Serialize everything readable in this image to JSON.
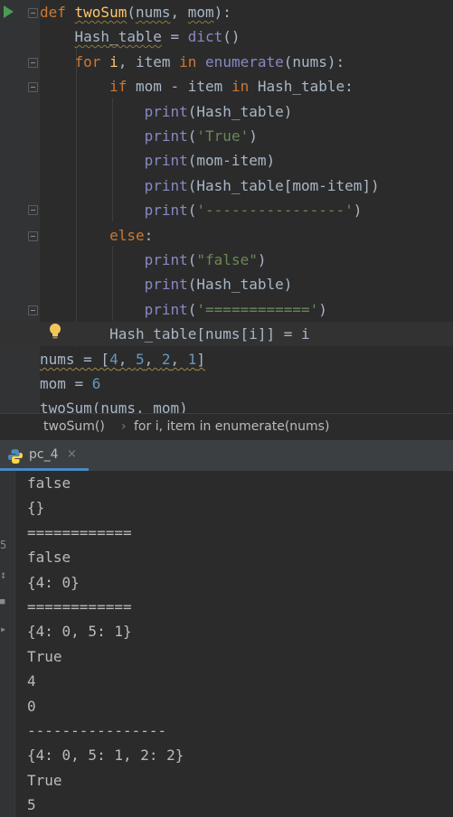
{
  "editor": {
    "lines": [
      {
        "parts": [
          [
            "kw",
            "def "
          ],
          [
            "fn wavy",
            "twoSum"
          ],
          [
            "",
            "("
          ],
          [
            "prm wavy",
            "nums"
          ],
          [
            "",
            ", "
          ],
          [
            "prm wavy",
            "mom"
          ],
          [
            "",
            "):"
          ]
        ]
      },
      {
        "parts": [
          [
            "",
            "    "
          ],
          [
            "wavy",
            "Hash_table"
          ],
          [
            "",
            " = "
          ],
          [
            "bi",
            "dict"
          ],
          [
            "",
            "()"
          ]
        ]
      },
      {
        "parts": [
          [
            "",
            "    "
          ],
          [
            "kw",
            "for "
          ],
          [
            "fn",
            "i"
          ],
          [
            "",
            ", item "
          ],
          [
            "kw",
            "in "
          ],
          [
            "bi",
            "enumerate"
          ],
          [
            "",
            "(nums):"
          ]
        ]
      },
      {
        "parts": [
          [
            "",
            "        "
          ],
          [
            "kw",
            "if "
          ],
          [
            "",
            "mom - item "
          ],
          [
            "kw",
            "in "
          ],
          [
            "",
            "Hash_table:"
          ]
        ]
      },
      {
        "parts": [
          [
            "",
            "            "
          ],
          [
            "bi",
            "print"
          ],
          [
            "",
            "(Hash_table)"
          ]
        ]
      },
      {
        "parts": [
          [
            "",
            "            "
          ],
          [
            "bi",
            "print"
          ],
          [
            "",
            "("
          ],
          [
            "str",
            "'True'"
          ],
          [
            "",
            ")"
          ]
        ]
      },
      {
        "parts": [
          [
            "",
            "            "
          ],
          [
            "bi",
            "print"
          ],
          [
            "",
            "(mom-item)"
          ]
        ]
      },
      {
        "parts": [
          [
            "",
            "            "
          ],
          [
            "bi",
            "print"
          ],
          [
            "",
            "(Hash_table[mom-item])"
          ]
        ]
      },
      {
        "parts": [
          [
            "",
            "            "
          ],
          [
            "bi",
            "print"
          ],
          [
            "",
            "("
          ],
          [
            "str",
            "'----------------'"
          ],
          [
            "",
            ")"
          ]
        ]
      },
      {
        "parts": [
          [
            "",
            "        "
          ],
          [
            "kw",
            "else"
          ],
          [
            "",
            ":"
          ]
        ]
      },
      {
        "parts": [
          [
            "",
            "            "
          ],
          [
            "bi",
            "print"
          ],
          [
            "",
            "("
          ],
          [
            "str",
            "\"false\""
          ],
          [
            "",
            ")"
          ]
        ]
      },
      {
        "parts": [
          [
            "",
            "            "
          ],
          [
            "bi",
            "print"
          ],
          [
            "",
            "(Hash_table)"
          ]
        ]
      },
      {
        "parts": [
          [
            "",
            "            "
          ],
          [
            "bi",
            "print"
          ],
          [
            "",
            "("
          ],
          [
            "str",
            "'============'"
          ],
          [
            "",
            ")"
          ]
        ]
      },
      {
        "parts": [
          [
            "",
            "        "
          ],
          [
            "",
            "Hash_table[nums["
          ],
          [
            "",
            "i"
          ],
          [
            "",
            "]] = i"
          ]
        ]
      },
      {
        "parts": [
          [
            "warn",
            "nums = ["
          ],
          [
            "num warn",
            "4"
          ],
          [
            "warn",
            ", "
          ],
          [
            "num warn",
            "5"
          ],
          [
            "warn",
            ", "
          ],
          [
            "num warn",
            "2"
          ],
          [
            "warn",
            ", "
          ],
          [
            "num warn",
            "1"
          ],
          [
            "warn",
            "]"
          ]
        ]
      },
      {
        "parts": [
          [
            "",
            "mom = "
          ],
          [
            "num",
            "6"
          ]
        ]
      },
      {
        "parts": [
          [
            "",
            "twoSum(nums, mom)"
          ]
        ]
      }
    ]
  },
  "breadcrumb": {
    "func": "twoSum()",
    "sep": "›",
    "loop": "for i, item in enumerate(nums)"
  },
  "run_panel": {
    "tab_label": "pc_4",
    "tab_close": "×",
    "accent": "#4a88c7"
  },
  "console": {
    "lines": [
      "false",
      "{}",
      "============",
      "false",
      "{4: 0}",
      "============",
      "{4: 0, 5: 1}",
      "True",
      "4",
      "0",
      "----------------",
      "{4: 0, 5: 1, 2: 2}",
      "True",
      "5"
    ]
  },
  "icons": {
    "run": "run-arrow-icon",
    "bulb": "lightbulb-icon",
    "python": "python-icon"
  }
}
